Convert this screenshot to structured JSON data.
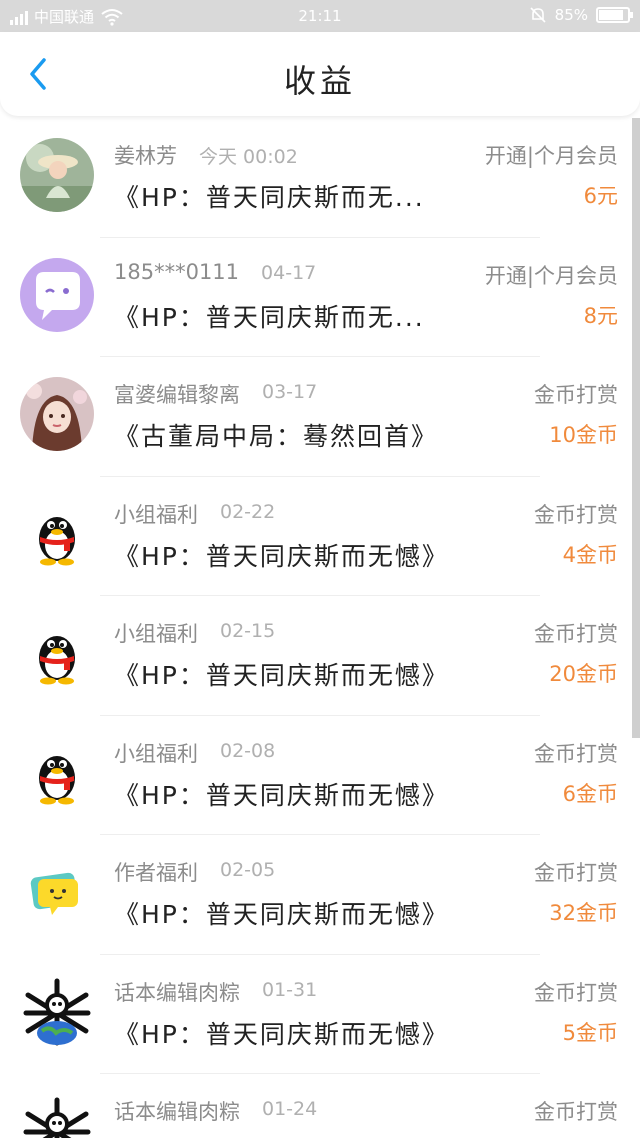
{
  "status_bar": {
    "carrier": "中国联通",
    "time": "21:11",
    "battery": "85%",
    "battery_level": 0.85
  },
  "header": {
    "title": "收益"
  },
  "items": [
    {
      "name": "姜林芳",
      "date": "今天 00:02",
      "type": "开通|个月会员",
      "book": "《HP：普天同庆斯而无...",
      "amount": "6元",
      "avatar": "photo-girl-hat"
    },
    {
      "name": "185***0111",
      "date": "04-17",
      "type": "开通|个月会员",
      "book": "《HP：普天同庆斯而无...",
      "amount": "8元",
      "avatar": "purple-chat-bubble"
    },
    {
      "name": "富婆编辑黎离",
      "date": "03-17",
      "type": "金币打赏",
      "book": "《古董局中局：蓦然回首》",
      "amount": "10金币",
      "avatar": "anime-girl"
    },
    {
      "name": "小组福利",
      "date": "02-22",
      "type": "金币打赏",
      "book": "《HP：普天同庆斯而无憾》",
      "amount": "4金币",
      "avatar": "penguin"
    },
    {
      "name": "小组福利",
      "date": "02-15",
      "type": "金币打赏",
      "book": "《HP：普天同庆斯而无憾》",
      "amount": "20金币",
      "avatar": "penguin"
    },
    {
      "name": "小组福利",
      "date": "02-08",
      "type": "金币打赏",
      "book": "《HP：普天同庆斯而无憾》",
      "amount": "6金币",
      "avatar": "penguin"
    },
    {
      "name": "作者福利",
      "date": "02-05",
      "type": "金币打赏",
      "book": "《HP：普天同庆斯而无憾》",
      "amount": "32金币",
      "avatar": "yellow-chat-bubble"
    },
    {
      "name": "话本编辑肉粽",
      "date": "01-31",
      "type": "金币打赏",
      "book": "《HP：普天同庆斯而无憾》",
      "amount": "5金币",
      "avatar": "skull-earth"
    },
    {
      "name": "话本编辑肉粽",
      "date": "01-24",
      "type": "金币打赏",
      "book": "",
      "amount": "",
      "avatar": "skull-earth"
    }
  ]
}
